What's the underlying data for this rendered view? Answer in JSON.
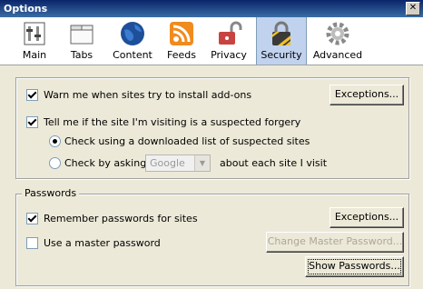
{
  "window": {
    "title": "Options",
    "close_glyph": "✕"
  },
  "toolbar": {
    "panes": [
      {
        "label": "Main",
        "icon": "main-icon"
      },
      {
        "label": "Tabs",
        "icon": "tabs-icon"
      },
      {
        "label": "Content",
        "icon": "content-globe-icon"
      },
      {
        "label": "Feeds",
        "icon": "feeds-icon"
      },
      {
        "label": "Privacy",
        "icon": "privacy-lock-icon"
      },
      {
        "label": "Security",
        "icon": "security-padlock-icon",
        "selected": true
      },
      {
        "label": "Advanced",
        "icon": "advanced-gear-icon"
      }
    ]
  },
  "addons": {
    "warn_label": "Warn me when sites try to install add-ons",
    "warn_checked": true,
    "exceptions_label": "Exceptions..."
  },
  "forgery": {
    "tell_label": "Tell me if the site I'm visiting is a suspected forgery",
    "tell_checked": true,
    "radio_downloaded_label": "Check using a downloaded list of suspected sites",
    "radio_ask_label": "Check by asking",
    "selected_radio": "downloaded",
    "provider_value": "Google",
    "suffix_label": "about each site I visit"
  },
  "passwords": {
    "legend": "Passwords",
    "remember_label": "Remember passwords for sites",
    "remember_checked": true,
    "exceptions_label": "Exceptions...",
    "master_label": "Use a master password",
    "master_checked": false,
    "change_master_label": "Change Master Password...",
    "show_passwords_label": "Show Passwords..."
  },
  "colors": {
    "selected_pane": "#c1d2ee",
    "titlebar": "#0a246a",
    "dialog_bg": "#ece9d8"
  }
}
